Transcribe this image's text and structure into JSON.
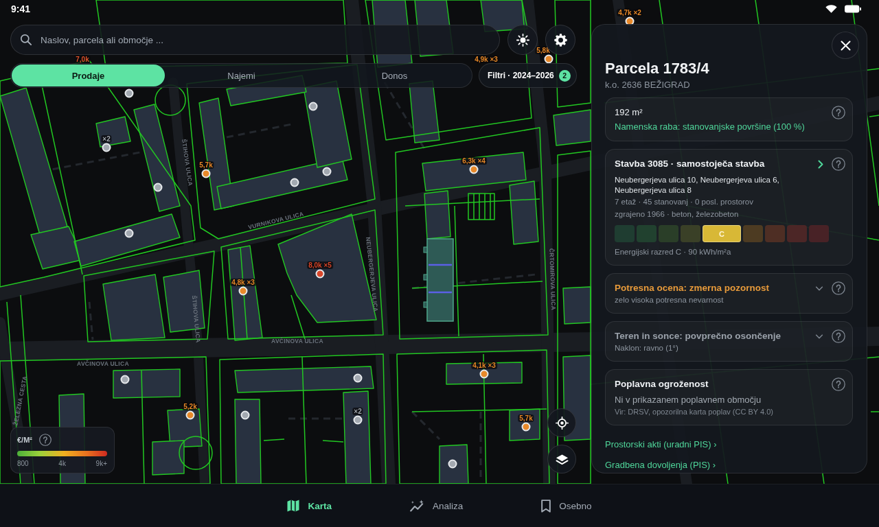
{
  "status_bar": {
    "time": "9:41"
  },
  "search": {
    "placeholder": "Naslov, parcela ali območje ..."
  },
  "mode_tabs": [
    {
      "label": "Prodaje",
      "selected": true
    },
    {
      "label": "Najemi",
      "selected": false
    },
    {
      "label": "Donos",
      "selected": false
    }
  ],
  "filter_chip": {
    "label": "Filtri · 2024–2026",
    "count": "2"
  },
  "map": {
    "streets": [
      "VURNIKOVA ULICA",
      "ŠTIHOVA ULICA",
      "NEUBERGERJEVA ULICA",
      "ŠTIHOVA ULICA",
      "ČRTOMIROVA ULICA",
      "AVČINOVA ULICA",
      "AVČINOVA ULICA",
      "ŽELEZNA CESTA"
    ],
    "markers": [
      {
        "label": "4,7k ×2",
        "color": "#e8892a"
      },
      {
        "label": "7,0k",
        "color": "#e0552e"
      },
      {
        "label": "4,9k ×3",
        "color": "#e8892a"
      },
      {
        "label": "5,8k",
        "color": "#e8892a"
      },
      {
        "color": "#a3a9b1"
      },
      {
        "color": "#a3a9b1"
      },
      {
        "label": "×2",
        "color": "#a3a9b1"
      },
      {
        "label": "6,3k ×4",
        "color": "#e8892a"
      },
      {
        "label": "5,7k",
        "color": "#e8892a"
      },
      {
        "color": "#a3a9b1"
      },
      {
        "color": "#a3a9b1"
      },
      {
        "color": "#a3a9b1"
      },
      {
        "color": "#a3a9b1"
      },
      {
        "label": "8,0k ×5",
        "color": "#d9472b"
      },
      {
        "label": "4,8k ×3",
        "color": "#e8892a"
      },
      {
        "label": "4,1k ×3",
        "color": "#e8892a"
      },
      {
        "color": "#a3a9b1"
      },
      {
        "color": "#a3a9b1"
      },
      {
        "label": "5,2k",
        "color": "#e8892a"
      },
      {
        "label": "×2",
        "color": "#a3a9b1"
      },
      {
        "color": "#a3a9b1"
      },
      {
        "label": "5,7k",
        "color": "#e8892a"
      },
      {
        "color": "#a3a9b1"
      }
    ]
  },
  "legend": {
    "title": "€/M²",
    "ticks": [
      "800",
      "4k",
      "9k+"
    ]
  },
  "detail_panel": {
    "title": "Parcela 1783/4",
    "subtitle": "k.o. 2636 BEŽIGRAD",
    "cards": [
      {
        "kind": "summary",
        "color": "#eef1f4",
        "title": "192 m²",
        "subtitle": "Namenska raba: stanovanjske površine (100 %)"
      },
      {
        "kind": "building",
        "color": "#eef1f4",
        "title": "Stavba 3085 · samostoječa stavba",
        "address": "Neubergerjeva ulica 10, Neubergerjeva ulica 6, Neubergerjeva ulica 8",
        "details": [
          "7 etaž · 45 stanovanj · 0 posl. prostorov",
          "zgrajeno 1966 · beton, železobeton"
        ],
        "energy_scale": [
          {
            "color": "#1f3d31",
            "selected": false
          },
          {
            "color": "#21412f",
            "selected": false
          },
          {
            "color": "#2a3e28",
            "selected": false
          },
          {
            "color": "#3a4027",
            "selected": false
          },
          {
            "label": "C",
            "color": "#d8b836",
            "selected": true
          },
          {
            "color": "#4d3b22",
            "selected": false
          },
          {
            "color": "#4e2e24",
            "selected": false
          },
          {
            "color": "#4c2626",
            "selected": false
          },
          {
            "color": "#482226",
            "selected": false
          }
        ],
        "energy_caption": "Energijski razred C · 90 kWh/m²a"
      },
      {
        "kind": "collapsible",
        "color": "#e79a3a",
        "expanded": false,
        "title": "Potresna ocena: zmerna pozornost",
        "subtitle": "zelo visoka potresna nevarnost"
      },
      {
        "kind": "collapsible",
        "color": "#9aa1aa",
        "expanded": false,
        "title": "Teren in sonce: povprečno osončenje",
        "subtitle": "Naklon: ravno (1°)"
      },
      {
        "kind": "info",
        "color": "#eef1f4",
        "title": "Poplavna ogroženost",
        "subtitle": "Ni v prikazanem poplavnem območju",
        "note": "Vir: DRSV, opozorilna karta poplav (CC BY 4.0)"
      }
    ],
    "links": [
      "Prostorski akti (uradni PIS) ›",
      "Gradbena dovoljenja (PIS) ›"
    ]
  },
  "bottom_nav": [
    {
      "kind": "map",
      "label": "Karta",
      "selected": true
    },
    {
      "kind": "analytics",
      "label": "Analiza",
      "selected": false
    },
    {
      "kind": "bookmark",
      "label": "Osebno",
      "selected": false
    }
  ]
}
